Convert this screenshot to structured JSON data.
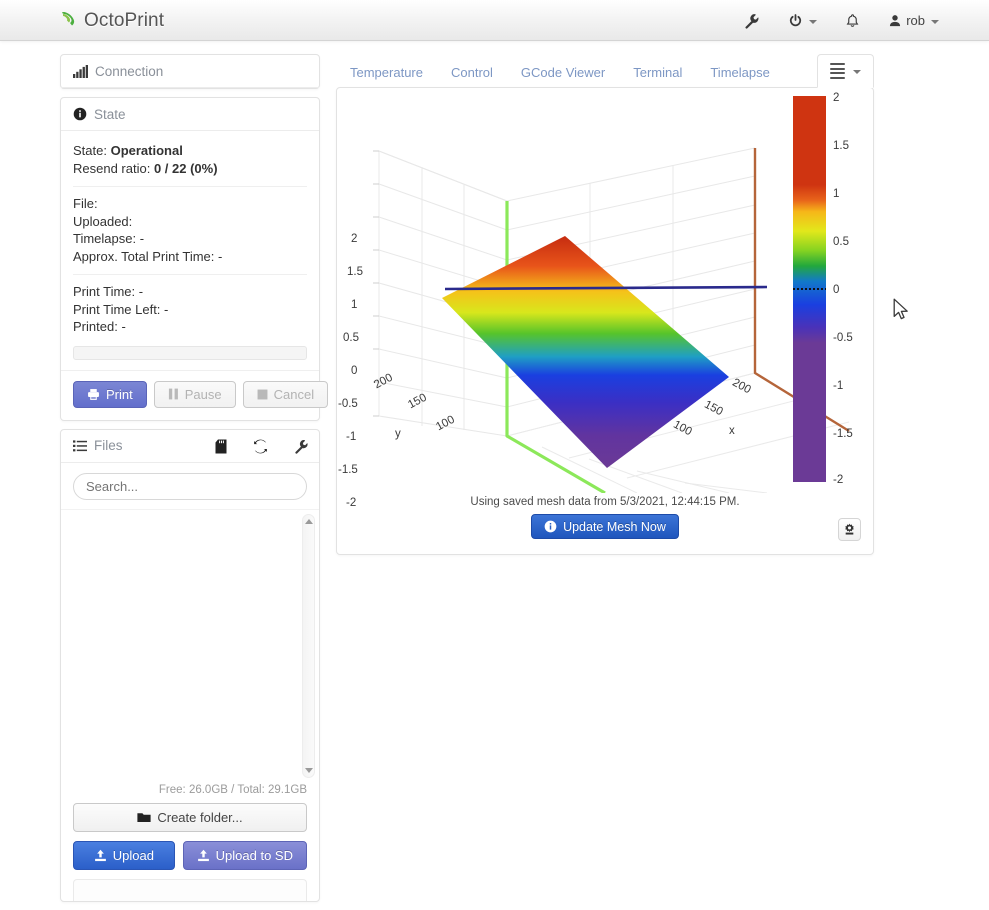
{
  "navbar": {
    "brand": "OctoPrint",
    "items": [
      {
        "name": "settings",
        "icon": "wrench-icon",
        "label": ""
      },
      {
        "name": "power",
        "icon": "power-icon",
        "label": "",
        "caret": true
      },
      {
        "name": "notifications",
        "icon": "bell-icon",
        "label": ""
      },
      {
        "name": "user",
        "icon": "user-icon",
        "label": "rob",
        "caret": true
      }
    ],
    "user_label": "rob"
  },
  "sidebar": {
    "connection": {
      "title": "Connection",
      "icon": "signal-icon"
    },
    "state": {
      "title": "State",
      "icon": "info-icon",
      "rows_top": [
        {
          "label": "State:",
          "value": "Operational"
        },
        {
          "label": "Resend ratio:",
          "value": "0 / 22 (0%)"
        }
      ],
      "rows_file": [
        {
          "label": "File:",
          "value": ""
        },
        {
          "label": "Uploaded:",
          "value": ""
        },
        {
          "label": "Timelapse:",
          "value": "-"
        },
        {
          "label": "Approx. Total Print Time:",
          "value": "-"
        }
      ],
      "rows_time": [
        {
          "label": "Print Time:",
          "value": "-"
        },
        {
          "label": "Print Time Left:",
          "value": "-"
        },
        {
          "label": "Printed:",
          "value": "-"
        }
      ],
      "buttons": [
        {
          "label": "Print",
          "icon": "printer-icon",
          "style": "primary",
          "disabled": false
        },
        {
          "label": "Pause",
          "icon": "pause-icon",
          "style": "default",
          "disabled": true
        },
        {
          "label": "Cancel",
          "icon": "stop-icon",
          "style": "default",
          "disabled": true
        }
      ]
    },
    "files": {
      "title": "Files",
      "icon": "list-icon",
      "head_icons": [
        "sdcard-icon",
        "refresh-icon",
        "wrench-icon"
      ],
      "search_placeholder": "Search...",
      "search_value": "",
      "free_total": "Free: 26.0GB / Total: 29.1GB",
      "create_folder_label": "Create folder...",
      "upload_label": "Upload",
      "upload_sd_label": "Upload to SD"
    }
  },
  "main": {
    "tabs": [
      {
        "label": "Temperature",
        "active": false
      },
      {
        "label": "Control",
        "active": false
      },
      {
        "label": "GCode Viewer",
        "active": false
      },
      {
        "label": "Terminal",
        "active": false
      },
      {
        "label": "Timelapse",
        "active": false
      }
    ],
    "menu_tab": {
      "icon": "hamburger-icon",
      "active": true
    },
    "mesh_note": "Using saved mesh data from 5/3/2021, 12:44:15 PM.",
    "update_button": {
      "label": "Update Mesh Now",
      "icon": "info-icon"
    },
    "settings_button": {
      "icon": "gear-icon"
    }
  },
  "chart_data": {
    "type": "surface",
    "title": "",
    "xlabel": "x",
    "ylabel": "y",
    "zlabel": "",
    "x_ticks": [
      100,
      150,
      200
    ],
    "y_ticks": [
      100,
      150,
      200
    ],
    "z_ticks": [
      2,
      1.5,
      1,
      0.5,
      0,
      -0.5,
      -1,
      -1.5,
      -2
    ],
    "z_tick_labels": [
      "2",
      "1.5",
      "1",
      "0.5",
      "0",
      "-0.5",
      "-1",
      "-1.5",
      "-2"
    ],
    "zlim": [
      -2,
      2
    ],
    "xlim": [
      80,
      220
    ],
    "ylim": [
      80,
      220
    ],
    "grid": true,
    "colorbar": {
      "ticks": [
        2,
        1.5,
        1,
        0.5,
        0,
        -0.5,
        -1,
        -1.5,
        -2
      ],
      "tick_labels": [
        "2",
        "1.5",
        "1",
        "0.5",
        "0",
        "-0.5",
        "-1",
        "-1.5",
        "-2"
      ],
      "range": [
        -2,
        2
      ],
      "colormap": "jet",
      "zero_marker": true
    },
    "surface_description": "tilted planar bed mesh, high (red, ~+0.4) at far corner, low (purple, ~-0.6) at near corner",
    "zero_plane_line": true,
    "axis_colors": {
      "y": "#8ce85a",
      "x": "#b5653a",
      "zero": "#2a2a8c"
    }
  }
}
